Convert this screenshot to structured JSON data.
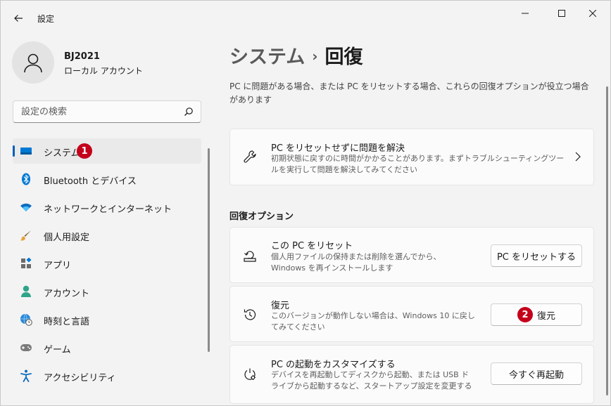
{
  "window": {
    "title": "設定"
  },
  "profile": {
    "name": "BJ2021",
    "account_type": "ローカル アカウント"
  },
  "search": {
    "placeholder": "設定の検索"
  },
  "sidebar": {
    "items": [
      {
        "label": "システム",
        "icon": "system-display-icon",
        "selected": true,
        "badge": "1"
      },
      {
        "label": "Bluetooth とデバイス",
        "icon": "bluetooth-icon"
      },
      {
        "label": "ネットワークとインターネット",
        "icon": "wifi-icon"
      },
      {
        "label": "個人用設定",
        "icon": "paintbrush-icon"
      },
      {
        "label": "アプリ",
        "icon": "apps-icon"
      },
      {
        "label": "アカウント",
        "icon": "person-icon"
      },
      {
        "label": "時刻と言語",
        "icon": "globe-clock-icon"
      },
      {
        "label": "ゲーム",
        "icon": "gamepad-icon"
      },
      {
        "label": "アクセシビリティ",
        "icon": "accessibility-icon"
      }
    ]
  },
  "breadcrumb": {
    "parent": "システム",
    "separator": "›",
    "current": "回復"
  },
  "description": "PC に問題がある場合、または PC をリセットする場合、これらの回復オプションが役立つ場合があります",
  "troubleshoot": {
    "title": "PC をリセットせずに問題を解決",
    "desc": "初期状態に戻すのに時間がかかることがあります。まずトラブルシューティングツールを実行して問題を解決してみてください"
  },
  "recovery_options": {
    "heading": "回復オプション",
    "items": [
      {
        "title": "この PC をリセット",
        "desc": "個人用ファイルの保持または削除を選んでから、Windows を再インストールします",
        "button": "PC をリセットする",
        "icon": "reset-pc-icon"
      },
      {
        "title": "復元",
        "desc": "このバージョンが動作しない場合は、Windows 10 に戻してみてください",
        "button": "復元",
        "button_badge": "2",
        "icon": "history-icon"
      },
      {
        "title": "PC の起動をカスタマイズする",
        "desc": "デバイスを再起動してディスクから起動、または USB ドライブから起動するなど、スタートアップ設定を変更する",
        "button": "今すぐ再起動",
        "icon": "advanced-startup-icon"
      }
    ]
  },
  "colors": {
    "accent": "#005fb8",
    "badge": "#c4001a",
    "background": "#f3f3f3",
    "card": "#fbfbfb"
  }
}
